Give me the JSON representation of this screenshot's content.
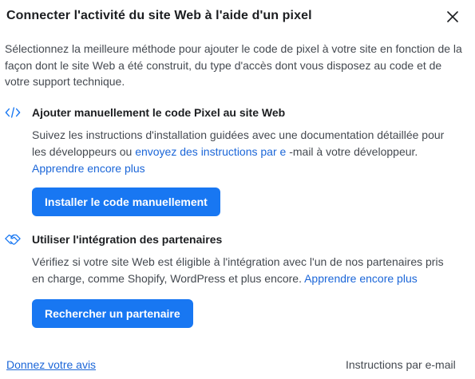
{
  "dialog": {
    "title": "Connecter l'activité du site Web à l'aide d'un pixel",
    "intro": "Sélectionnez la meilleure méthode pour ajouter le code de pixel à votre site en fonction de la façon dont le site Web a été construit, du type d'accès dont vous disposez au code et de votre support technique."
  },
  "manual": {
    "icon": "code-icon",
    "heading": "Ajouter manuellement le code Pixel au site Web",
    "desc_text1": "Suivez les instructions d'installation guidées avec une documentation détaillée pour les développeurs ou ",
    "desc_link1": "envoyez des instructions par e",
    "desc_text2": " -mail à votre développeur. ",
    "desc_link2": "Apprendre encore plus",
    "button_label": "Installer le code manuellement"
  },
  "partner": {
    "icon": "handshake-icon",
    "heading": "Utiliser l'intégration des partenaires",
    "desc_text1": "Vérifiez si votre site Web est éligible à l'intégration avec l'un de nos partenaires pris en charge, comme Shopify, WordPress et plus encore. ",
    "desc_link1": "Apprendre encore plus",
    "button_label": "Rechercher un partenaire"
  },
  "footer": {
    "feedback_link": "Donnez votre avis",
    "email_instructions": "Instructions par e-mail"
  },
  "colors": {
    "accent": "#1877f2",
    "link": "#1b66d8",
    "text": "#1c1e21",
    "muted": "#444950"
  }
}
